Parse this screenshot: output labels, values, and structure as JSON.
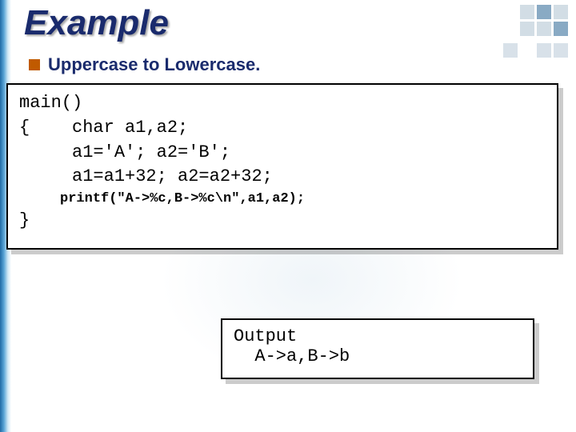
{
  "title": "Example",
  "subtitle": "Uppercase to Lowercase.",
  "code": {
    "l1": "main()",
    "l2": "{    char a1,a2;",
    "l3": "     a1='A'; a2='B';",
    "l4": "     a1=a1+32; a2=a2+32;",
    "l5": "     printf(\"A->%c,B->%c\\n\",a1,a2);",
    "l6": "}"
  },
  "output": {
    "label": "Output",
    "line": "  A->a,B->b"
  }
}
